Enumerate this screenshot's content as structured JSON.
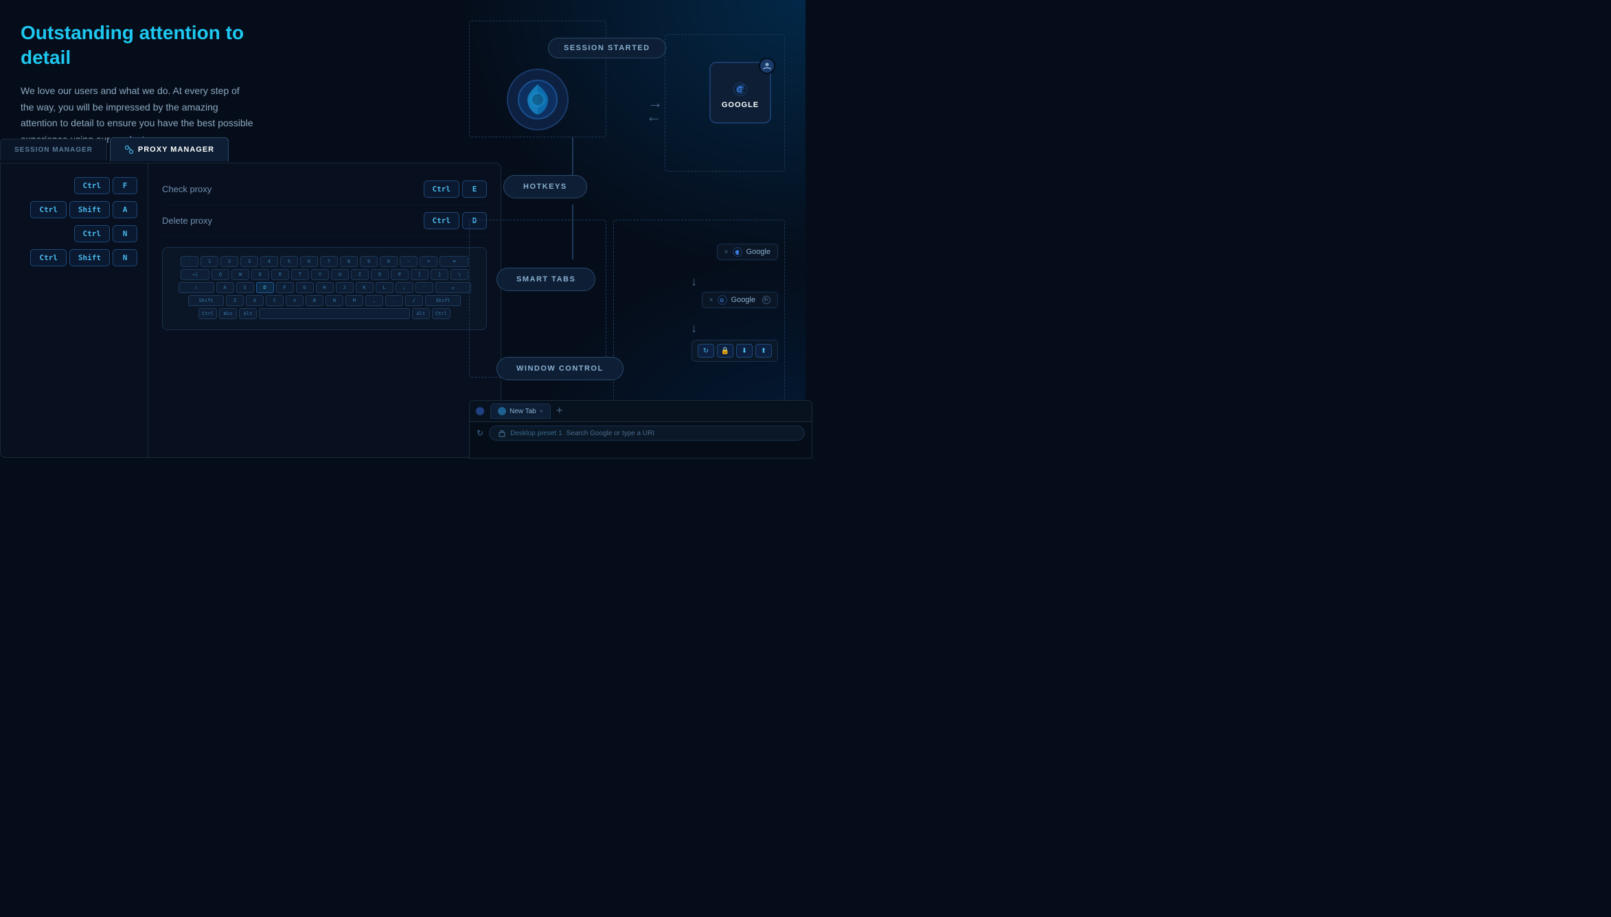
{
  "page": {
    "title": "Outstanding attention to detail",
    "description": "We love our users and what we do. At every step of the way, you will be impressed by the amazing attention to detail to ensure you have the best possible experience using our products."
  },
  "tabs": [
    {
      "id": "session",
      "label": "SESSION MANAGER",
      "active": false
    },
    {
      "id": "proxy",
      "label": "PROXY MANAGER",
      "active": true
    }
  ],
  "proxy_manager": {
    "rows": [
      {
        "label": "Check proxy",
        "keys": [
          "Ctrl",
          "E"
        ]
      },
      {
        "label": "Delete proxy",
        "keys": [
          "Ctrl",
          "D"
        ]
      }
    ]
  },
  "left_hotkeys": [
    {
      "keys": [
        "Ctrl",
        "F"
      ]
    },
    {
      "keys": [
        "Ctrl",
        "Shift",
        "A"
      ]
    },
    {
      "keys": [
        "Ctrl",
        "N"
      ]
    },
    {
      "keys": [
        "Ctrl",
        "Shift",
        "N"
      ]
    }
  ],
  "keyboard": {
    "rows": [
      [
        "`",
        "1",
        "2",
        "3",
        "4",
        "5",
        "6",
        "7",
        "8",
        "9",
        "0",
        "-",
        "=",
        "⌫"
      ],
      [
        "→|",
        "Q",
        "W",
        "E",
        "R",
        "T",
        "Y",
        "U",
        "I",
        "O",
        "P",
        "[",
        "]",
        "\\"
      ],
      [
        "⇪",
        "A",
        "S",
        "D",
        "F",
        "G",
        "H",
        "J",
        "K",
        "L",
        ";",
        "'",
        "↵"
      ],
      [
        "Shift",
        "Z",
        "X",
        "C",
        "V",
        "B",
        "N",
        "M",
        ",",
        ".",
        "/",
        "Shift"
      ],
      [
        "Ctrl",
        "Win",
        "Alt",
        "",
        "Alt",
        "Ctrl"
      ]
    ],
    "highlighted": [
      "D"
    ]
  },
  "diagram": {
    "session_started": "SESSION STARTED",
    "hotkeys": "HOTKEYS",
    "smart_tabs": "SMART TABS",
    "window_control": "WINDOW CONTROL",
    "google_label": "GOOGLE",
    "tab_labels": [
      "× G Google",
      "× G Google"
    ],
    "browser_tab": "New Tab",
    "address_placeholder": "Search Google or type a URI",
    "preset_label": "Desktop preset 1"
  },
  "colors": {
    "accent": "#1ec8f0",
    "text_primary": "#fff",
    "text_secondary": "#8ca8c0",
    "border": "#1a2a3a",
    "bg_dark": "#050d1a",
    "bg_panel": "#080f1e",
    "key_color": "#4ab8e8"
  }
}
